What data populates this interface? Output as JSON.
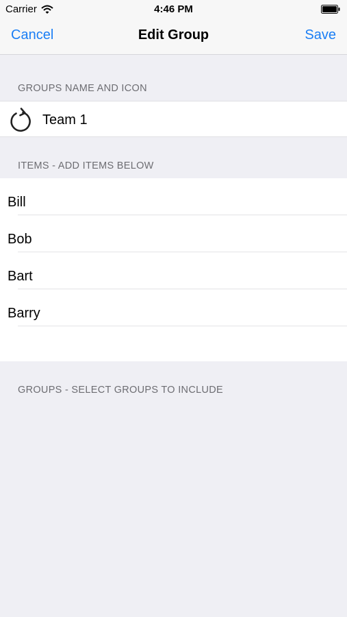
{
  "status_bar": {
    "carrier": "Carrier",
    "time": "4:46 PM",
    "icons": [
      "wifi-icon",
      "battery-icon"
    ]
  },
  "nav": {
    "cancel_label": "Cancel",
    "title": "Edit Group",
    "save_label": "Save"
  },
  "sections": {
    "name_icon_header": "GROUPS NAME AND ICON",
    "items_header": "ITEMS - ADD ITEMS BELOW",
    "groups_header": "GROUPS - SELECT GROUPS TO INCLUDE"
  },
  "group": {
    "icon": "refresh-icon",
    "name": "Team 1"
  },
  "items": [
    {
      "label": "Bill"
    },
    {
      "label": "Bob"
    },
    {
      "label": "Bart"
    },
    {
      "label": "Barry"
    }
  ],
  "colors": {
    "accent": "#1a7ef5",
    "background": "#efeff4",
    "section_text": "#6d6d72"
  }
}
